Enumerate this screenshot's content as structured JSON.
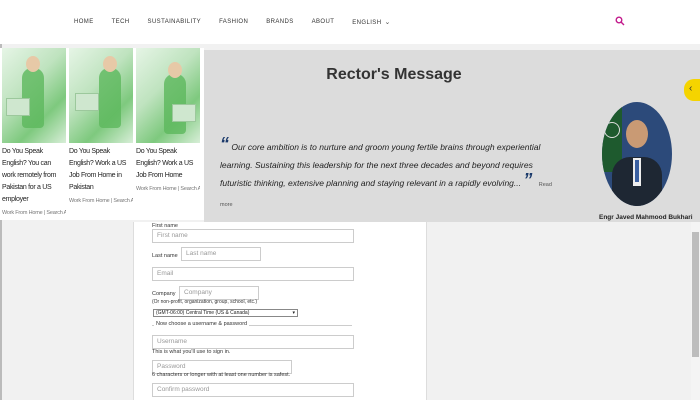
{
  "nav": {
    "items": [
      "HOME",
      "TECH",
      "SUSTAINABILITY",
      "FASHION",
      "BRANDS",
      "ABOUT",
      "ENGLISH"
    ]
  },
  "ads": [
    {
      "title": "Do You Speak English? You can work remotely from Pakistan for a US employer",
      "source": "Work From Home | Search Ads · Sponsored"
    },
    {
      "title": "Do You Speak English? Work a US Job From Home in Pakistan",
      "source": "Work From Home | Search Ads · Sponsored"
    },
    {
      "title": "Do You Speak English? Work a US Job From Home",
      "source": "Work From Home | Search Ads · Sponsored"
    }
  ],
  "rector": {
    "title": "Rector's Message",
    "quote": "Our core ambition is to nurture and groom young fertile brains through experiential learning. Sustaining this leadership for the next three decades and beyond requires futuristic thinking, extensive planning and staying relevant in a rapidly evolving...",
    "read_more": "Read more",
    "name": "Engr Javed Mahmood Bukhari"
  },
  "form": {
    "first_name_label": "First name",
    "first_name_placeholder": "First name",
    "last_name_label": "Last name",
    "last_name_placeholder": "Last name",
    "email_placeholder": "Email",
    "company_label": "Company",
    "company_placeholder": "Company",
    "company_hint": "(Or non-profit, organization, group, school, etc.)",
    "timezone_value": "(GMT-06:00) Central Time (US & Canada)",
    "username_legend": "Now choose a username & password",
    "username_placeholder": "Username",
    "username_hint": "This is what you'll use to sign in.",
    "password_placeholder": "Password",
    "password_hint": "6 characters or longer with at least one number is safest.",
    "confirm_password_placeholder": "Confirm password"
  },
  "colors": {
    "search_accent": "#c21a8c",
    "quote_accent": "#1b3a6b",
    "side_tab": "#f5d400"
  }
}
